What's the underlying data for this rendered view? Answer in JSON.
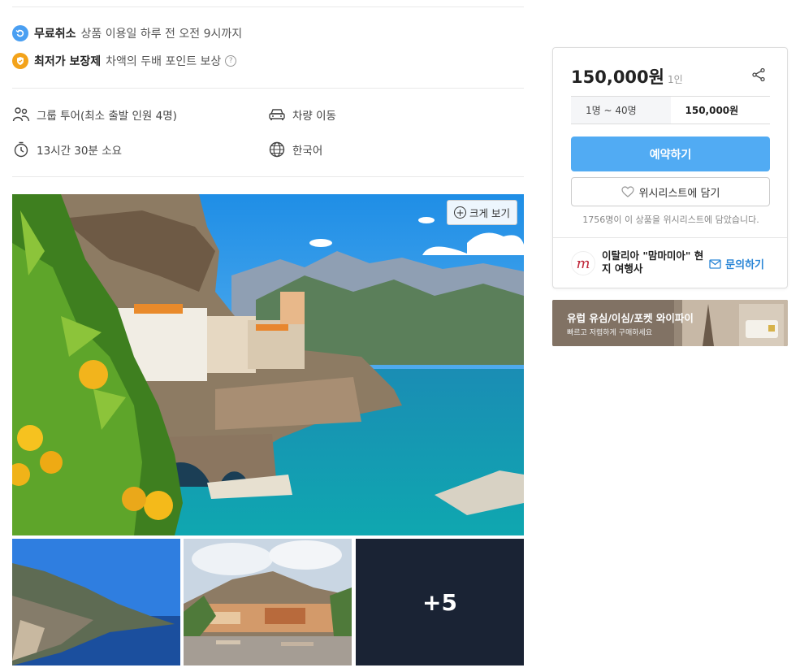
{
  "policies": [
    {
      "strong": "무료취소",
      "text": "상품 이용일 하루 전 오전 9시까지",
      "icon": "refresh-icon",
      "color": "#4a9ff2"
    },
    {
      "strong": "최저가 보장제",
      "text": "차액의 두배 포인트 보상",
      "icon": "shield-icon",
      "color": "#f3a31b"
    }
  ],
  "qmark": "?",
  "features": {
    "group": "그룹 투어(최소 출발 인원 4명)",
    "vehicle": "차량 이동",
    "duration": "13시간 30분 소요",
    "language": "한국어"
  },
  "gallery": {
    "zoom_label": "크게 보기",
    "more_label": "+5"
  },
  "booking": {
    "price": "150,000원",
    "per": "1인",
    "range_label": "1명 ~ 40명",
    "range_price": "150,000원",
    "book_label": "예약하기",
    "wish_label": "위시리스트에 담기",
    "wish_count_text": "1756명이 이 상품을 위시리스트에 담았습니다.",
    "agency_name": "이탈리아 \"맘마미아\" 현지 여행사",
    "agency_logo_letter": "m",
    "inquiry_label": "문의하기",
    "accent": "#51abf3"
  },
  "banner": {
    "title": "유럽 유심/이심/포켓 와이파이",
    "subtitle": "빠르고 저렴하게 구매하세요"
  }
}
